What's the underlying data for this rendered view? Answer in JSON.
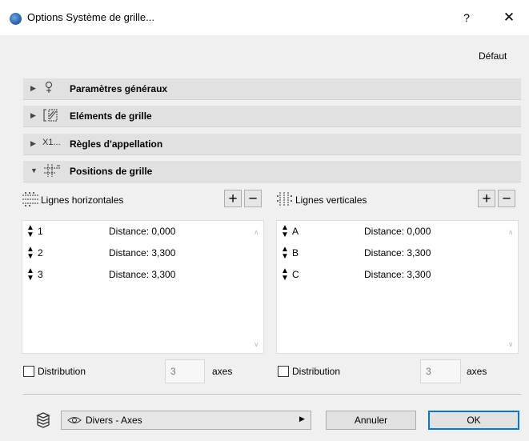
{
  "window": {
    "title": "Options Système de grille...",
    "help": "?",
    "close": "✕"
  },
  "header": {
    "default_label": "Défaut"
  },
  "sections": [
    {
      "label": "Paramètres généraux",
      "icon": "pin-icon",
      "expanded": false
    },
    {
      "label": "Eléments de grille",
      "icon": "grid-elements-icon",
      "expanded": false
    },
    {
      "label": "Règles d'appellation",
      "icon": "naming-icon",
      "icon_text": "X1...",
      "expanded": false
    },
    {
      "label": "Positions de grille",
      "icon": "grid-positions-icon",
      "expanded": true
    }
  ],
  "horizontal": {
    "title": "Lignes horizontales",
    "plus": "+",
    "minus": "−",
    "rows": [
      {
        "name": "1",
        "distance": "Distance: 0,000"
      },
      {
        "name": "2",
        "distance": "Distance: 3,300"
      },
      {
        "name": "3",
        "distance": "Distance: 3,300"
      }
    ],
    "distribution_label": "Distribution",
    "distribution_checked": false,
    "axes_count": "3",
    "axes_label": "axes"
  },
  "vertical": {
    "title": "Lignes verticales",
    "plus": "+",
    "minus": "−",
    "rows": [
      {
        "name": "A",
        "distance": "Distance: 0,000"
      },
      {
        "name": "B",
        "distance": "Distance: 3,300"
      },
      {
        "name": "C",
        "distance": "Distance: 3,300"
      }
    ],
    "distribution_label": "Distribution",
    "distribution_checked": false,
    "axes_count": "3",
    "axes_label": "axes"
  },
  "footer": {
    "layer_name": "Divers - Axes",
    "cancel_label": "Annuler",
    "ok_label": "OK"
  },
  "colors": {
    "primary_border": "#0078d7",
    "section_bg": "#e1e1e1",
    "dialog_bg": "#f0f0f0"
  }
}
